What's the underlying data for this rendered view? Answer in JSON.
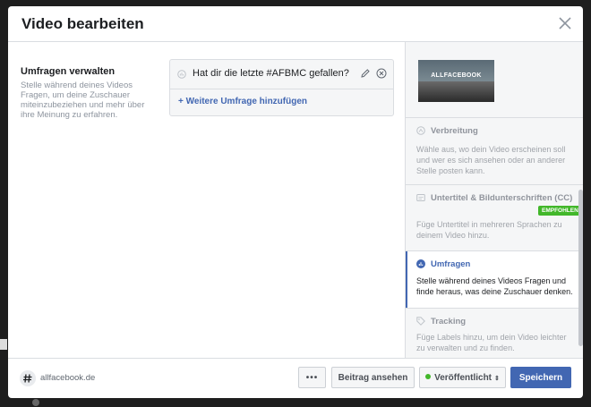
{
  "modal": {
    "title": "Video bearbeiten"
  },
  "polls": {
    "title": "Umfragen verwalten",
    "description": "Stelle während deines Videos Fragen, um deine Zuschauer miteinzubeziehen und mehr über ihre Meinung zu erfahren.",
    "question": "Hat dir die letzte #AFBMC gefallen?",
    "add_label": "+ Weitere Umfrage hinzufügen"
  },
  "sidebar": {
    "thumbnail_logo": "ALLFACEBOOK",
    "items": [
      {
        "title": "Verbreitung",
        "description": "Wähle aus, wo dein Video erscheinen soll und wer es sich ansehen oder an anderer Stelle posten kann.",
        "icon": "distribution-icon"
      },
      {
        "title": "Untertitel & Bildunterschriften (CC)",
        "badge": "EMPFOHLEN",
        "description": "Füge Untertitel in mehreren Sprachen zu deinem Video hinzu.",
        "icon": "captions-icon"
      },
      {
        "title": "Umfragen",
        "description": "Stelle während deines Videos Fragen und finde heraus, was deine Zuschauer denken.",
        "icon": "poll-icon",
        "active": true
      },
      {
        "title": "Tracking",
        "description": "Füge Labels hinzu, um dein Video leichter zu verwalten und zu finden.",
        "icon": "tag-icon"
      }
    ]
  },
  "footer": {
    "page_name": "allfacebook.de",
    "more_label": "•••",
    "view_label": "Beitrag ansehen",
    "status_label": "Veröffentlicht",
    "save_label": "Speichern"
  },
  "colors": {
    "accent": "#4267b2",
    "badge": "#42b72a",
    "status": "#42b72a"
  }
}
